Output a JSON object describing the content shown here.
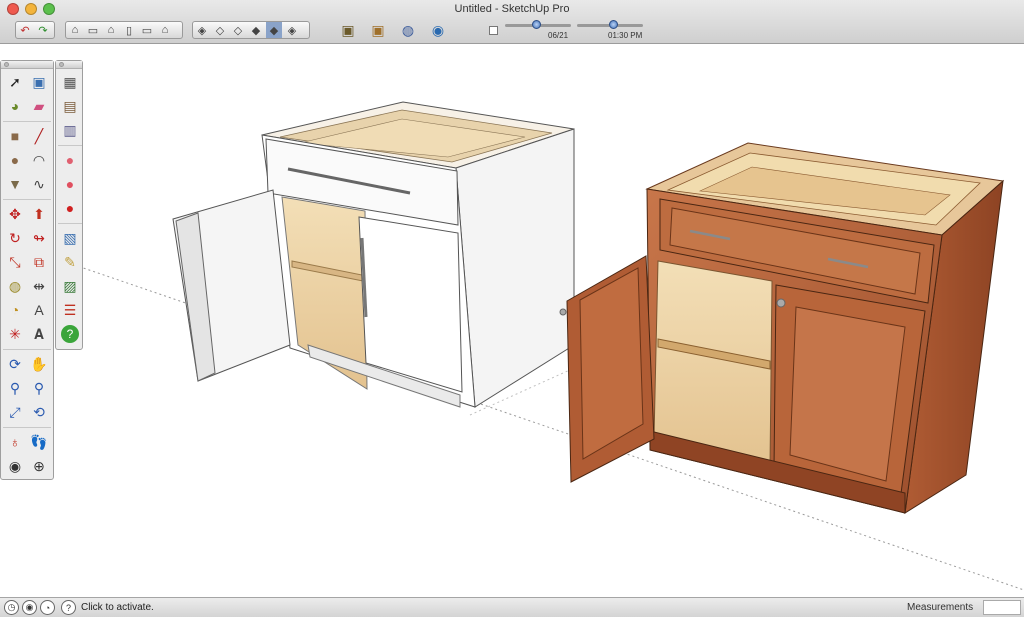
{
  "window": {
    "title": "Untitled - SketchUp Pro"
  },
  "toolbar": {
    "group1": [
      "undo-icon",
      "redo-icon"
    ],
    "group2": [
      "iso-view-icon",
      "top-view-icon",
      "front-view-icon",
      "right-view-icon",
      "back-view-icon",
      "left-view-icon"
    ],
    "group3": [
      "xray-style-icon",
      "wireframe-style-icon",
      "hidden-line-style-icon",
      "shaded-style-icon",
      "shaded-textures-style-icon",
      "monochrome-style-icon"
    ],
    "group4": [
      "get-models-icon",
      "share-model-icon",
      "components-icon",
      "google-earth-icon"
    ],
    "shadows": {
      "date": "06/21",
      "time": "01:30 PM",
      "date_level": 0.47,
      "time_level": 0.55
    }
  },
  "palette_main": [
    "select-icon",
    "make-component-icon",
    "paint-bucket-icon",
    "eraser-icon",
    "rectangle-icon",
    "line-icon",
    "circle-icon",
    "arc-icon",
    "polygon-icon",
    "freehand-icon",
    "move-icon",
    "push-pull-icon",
    "rotate-icon",
    "follow-me-icon",
    "scale-icon",
    "offset-icon",
    "tape-measure-icon",
    "dimension-icon",
    "protractor-icon",
    "text-icon",
    "axes-icon",
    "3d-text-icon",
    "orbit-icon",
    "pan-icon",
    "zoom-icon",
    "zoom-window-icon",
    "zoom-extents-icon",
    "previous-view-icon",
    "position-camera-icon",
    "walk-icon",
    "look-around-icon",
    "section-plane-icon"
  ],
  "palette_side": [
    "sandbox-icon",
    "stamp-icon",
    "drape-icon",
    "ruby-console-icon",
    "ruby-icon",
    "ruby-red-icon",
    "layers-icon",
    "sketch-icon",
    "photo-match-icon",
    "adjust-icon",
    "help-icon"
  ],
  "status": {
    "hint": "Click to activate.",
    "measurements_label": "Measurements",
    "measurements_value": ""
  },
  "colors": {
    "wood": "#b7643a",
    "white_cabinet": "#f2f2f2",
    "interior": "#eed9b4"
  }
}
